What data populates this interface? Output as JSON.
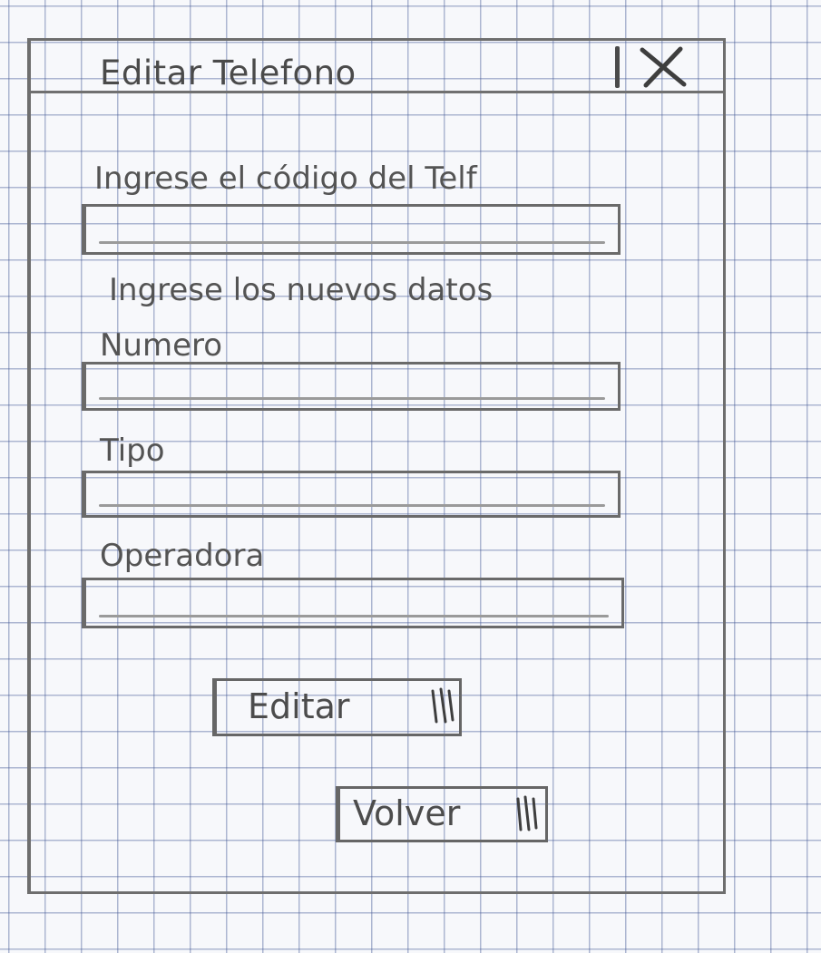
{
  "window": {
    "title": "Editar Telefono",
    "close_label": "X"
  },
  "form": {
    "code_label": "Ingrese el código del Telf",
    "code_value": "",
    "section_label": "Ingrese los nuevos datos",
    "numero_label": "Numero",
    "numero_value": "",
    "tipo_label": "Tipo",
    "tipo_value": "",
    "operadora_label": "Operadora",
    "operadora_value": ""
  },
  "actions": {
    "edit_label": "Editar",
    "back_label": "Volver"
  },
  "icons": {
    "close": "close-icon",
    "button_hatch": "hatch-icon"
  },
  "colors": {
    "paper": "#f7f8fb",
    "grid": "#465a96",
    "pencil": "#4e4e4e"
  }
}
